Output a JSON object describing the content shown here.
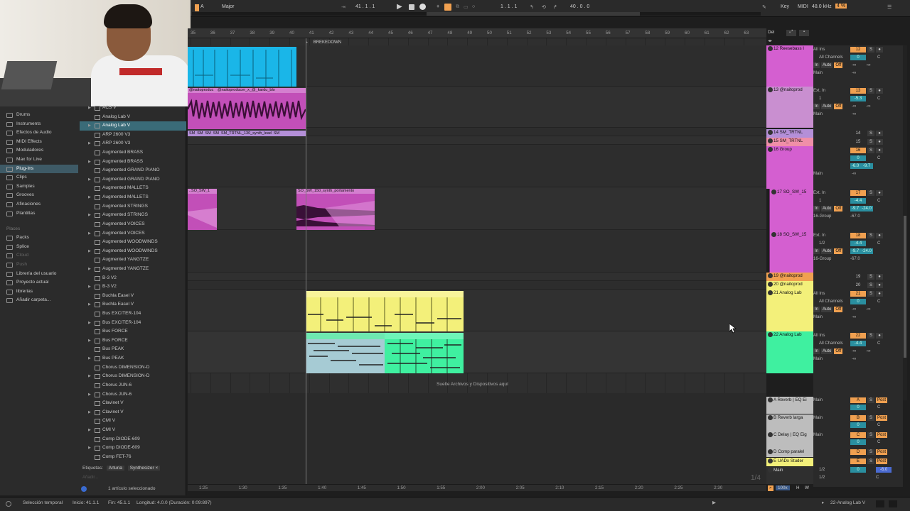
{
  "transport": {
    "key_root": "A",
    "scale": "Major",
    "position": "41 .   1 .   1",
    "loop_start": "1 .   1 .   1",
    "loop_length": "40 .   0 .   0",
    "key_label": "Key",
    "midi_label": "MIDI",
    "sample_rate": "48.0 kHz",
    "cpu": "4 %"
  },
  "colors": {
    "cyan": "#1ab6e8",
    "magenta": "#d45fd0",
    "pink_clip": "#c24fb8",
    "yellow": "#f3f07a",
    "green": "#3ff0a0",
    "orange": "#f0a050",
    "light_blue_clip": "#a6cbd4"
  },
  "browser": {
    "categories": [
      {
        "label": "Drums",
        "icon": "drums-icon"
      },
      {
        "label": "Instruments",
        "icon": "instruments-icon"
      },
      {
        "label": "Efectos de Audio",
        "icon": "audio-effects-icon"
      },
      {
        "label": "MIDI Effects",
        "icon": "midi-effects-icon"
      },
      {
        "label": "Moduladores",
        "icon": "modulators-icon"
      },
      {
        "label": "Max for Live",
        "icon": "max-icon"
      },
      {
        "label": "Plug-Ins",
        "icon": "plugin-icon"
      },
      {
        "label": "Clips",
        "icon": "clips-icon"
      },
      {
        "label": "Samples",
        "icon": "samples-icon"
      },
      {
        "label": "Grooves",
        "icon": "grooves-icon"
      },
      {
        "label": "Afinaciones",
        "icon": "tuning-icon"
      },
      {
        "label": "Plantillas",
        "icon": "templates-icon"
      }
    ],
    "places_header": "Places",
    "places": [
      {
        "label": "Packs",
        "icon": "packs-icon"
      },
      {
        "label": "Splice",
        "icon": "splice-icon"
      },
      {
        "label": "Cloud",
        "icon": "cloud-icon"
      },
      {
        "label": "Push",
        "icon": "push-icon"
      },
      {
        "label": "Librería del usuario",
        "icon": "user-library-icon"
      },
      {
        "label": "Proyecto actual",
        "icon": "current-project-icon"
      },
      {
        "label": "librerias",
        "icon": "folder-icon"
      },
      {
        "label": "Añadir carpeta...",
        "icon": "add-folder-icon"
      }
    ],
    "items": [
      "ACS V",
      "Analog Lab V",
      "Analog Lab V",
      "ARP 2600 V3",
      "ARP 2600 V3",
      "Augmented BRASS",
      "Augmented BRASS",
      "Augmented GRAND PIANO",
      "Augmented GRAND PIANO",
      "Augmented MALLETS",
      "Augmented MALLETS",
      "Augmented STRINGS",
      "Augmented STRINGS",
      "Augmented VOICES",
      "Augmented VOICES",
      "Augmented WOODWINDS",
      "Augmented WOODWINDS",
      "Augmented YANGTZE",
      "Augmented YANGTZE",
      "B-3 V2",
      "B-3 V2",
      "Buchla Easel V",
      "Buchla Easel V",
      "Bus EXCITER-104",
      "Bus EXCITER-104",
      "Bus FORCE",
      "Bus FORCE",
      "Bus PEAK",
      "Bus PEAK",
      "Chorus DIMENSION-D",
      "Chorus DIMENSION-D",
      "Chorus JUN-6",
      "Chorus JUN-6",
      "Clavinet V",
      "Clavinet V",
      "CMI V",
      "CMI V",
      "Comp DIODE-609",
      "Comp DIODE-609",
      "Comp FET-76"
    ],
    "tags_label": "Etiquetas:",
    "tags": [
      "Arturia",
      "Synthesizer ×"
    ],
    "add_placeholder": "Añadir...",
    "selection_info": "1 artículo seleccionado"
  },
  "ruler": {
    "bars": [
      "35",
      "36",
      "37",
      "38",
      "39",
      "40",
      "41",
      "42",
      "43",
      "44",
      "45",
      "46",
      "47",
      "48",
      "49",
      "50",
      "51",
      "52",
      "53",
      "54",
      "55",
      "56",
      "57",
      "58",
      "59",
      "60",
      "61",
      "62",
      "63"
    ],
    "locator": "BREKEDOWN",
    "times": [
      "1:25",
      "1:30",
      "1:35",
      "1:40",
      "1:45",
      "1:50",
      "1:55",
      "2:00",
      "2:05",
      "2:10",
      "2:15",
      "2:20",
      "2:25",
      "2:30"
    ],
    "grid_label": "1/4",
    "drop_text": "Suelte Archivos y Dispositivos aquí"
  },
  "clips": {
    "c13_names": [
      "@naitoproduc",
      "@naitoproducer_x_@_kardu_blo"
    ],
    "c13_small": [
      "SM",
      "SM",
      "SM",
      "SM",
      "SM_TRTNL_130_synth_lead",
      "SM"
    ],
    "c17a": "..SO_SW_1",
    "c17b": "SO_SW_150_synth_portamento"
  },
  "tracks": [
    {
      "name": "12 Reesebass I",
      "num": "12",
      "input": "All Ins",
      "sub": "All Channels",
      "out": "Main",
      "vol": "0",
      "pan": "C"
    },
    {
      "name": "13 @naitoprod",
      "num": "13",
      "input": "Ext. In",
      "sub": "1",
      "out": "Main",
      "vol": "-5.3",
      "pan": "C"
    },
    {
      "name": "14 SM_TRTNL",
      "num": "14"
    },
    {
      "name": "15 SM_TRTNL",
      "num": "15"
    },
    {
      "name": "16 Group",
      "num": "16",
      "out": "Main",
      "vol": "0",
      "pan": "C",
      "sa": "-6.0",
      "sb": "-9.7"
    },
    {
      "name": "17 SO_SW_15",
      "num": "17",
      "input": "Ext. In",
      "sub": "1",
      "out": "16-Group",
      "vol": "-4.4",
      "pan": "C",
      "sa": "-9.7",
      "sb": "-24.0",
      "send": "-67.0"
    },
    {
      "name": "18 SO_SW_15",
      "num": "18",
      "input": "Ext. In",
      "sub": "1/2",
      "out": "16-Group",
      "vol": "-4.4",
      "pan": "C",
      "sa": "-9.7",
      "sb": "-24.0",
      "send": "-67.0"
    },
    {
      "name": "19 @naitoprod",
      "num": "19"
    },
    {
      "name": "20 @naitoprod",
      "num": "20"
    },
    {
      "name": "21 Analog Lab",
      "num": "21",
      "input": "All Ins",
      "sub": "All Channels",
      "out": "Main",
      "vol": "0",
      "pan": "C"
    },
    {
      "name": "22 Analog Lab",
      "num": "22",
      "input": "All Ins",
      "sub": "All Channels",
      "out": "Main",
      "vol": "-4.4",
      "pan": "C"
    }
  ],
  "returns": [
    {
      "name": "A Reverb | EQ Ei",
      "letter": "A",
      "out": "Main",
      "vol": "0",
      "pan": "C",
      "post": "Post"
    },
    {
      "name": "B Reverb larga",
      "letter": "B",
      "out": "Main",
      "vol": "0",
      "pan": "C",
      "post": "Post"
    },
    {
      "name": "C Delay | EQ Eig",
      "letter": "C",
      "out": "Main",
      "vol": "0",
      "pan": "C",
      "post": "Post"
    },
    {
      "name": "D Comp paralel",
      "letter": "D",
      "post": "Post"
    },
    {
      "name": "E UADx Studer",
      "letter": "E",
      "post": "Post"
    }
  ],
  "main": {
    "name": "Main",
    "sub": "1/2",
    "sub2": "1/2",
    "vol": "0",
    "pan": "C",
    "gain": "-6.0"
  },
  "mon": {
    "in": "In",
    "auto": "Auto",
    "off": "Off",
    "inf": "-∞",
    "sbtn": "S",
    "ext_sub": "All Channels"
  },
  "top_right": {
    "del": "Del",
    "zoom": "100x",
    "h": "H",
    "w": "W"
  },
  "status": {
    "mode": "Selección temporal",
    "start": "Inicio: 41.1.1",
    "end": "Fin: 45.1.1",
    "length": "Longitud: 4.0.0 (Duración: 0:09:897)",
    "track": "22-Analog Lab V"
  }
}
